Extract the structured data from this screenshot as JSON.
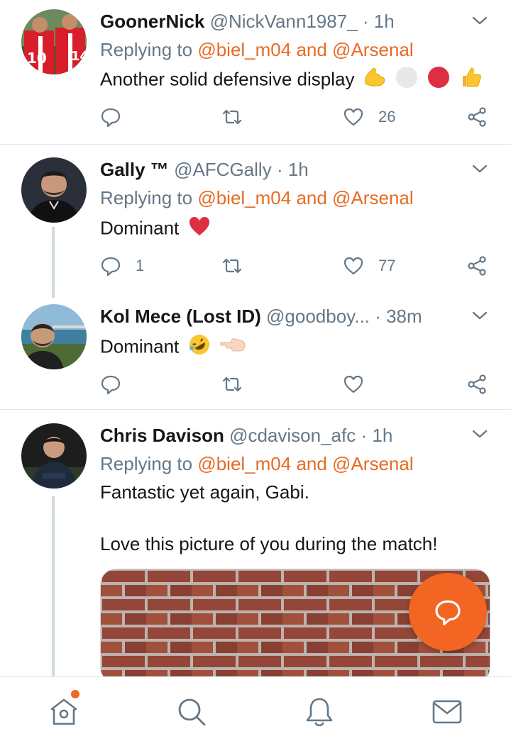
{
  "colors": {
    "accent": "#e86a24",
    "fab": "#f26522",
    "muted": "#657786",
    "divider": "#e1e8ed"
  },
  "tweets": [
    {
      "name": "GoonerNick",
      "handle": "@NickVann1987_",
      "sep": "·",
      "time": "1h",
      "replying_prefix": "Replying to",
      "replying_mentions": "@biel_m04 and @Arsenal",
      "text": "Another solid defensive display",
      "emojis": [
        "flexed-biceps",
        "white-circle",
        "red-circle",
        "thumbs-up"
      ],
      "reply_count": "",
      "like_count": "26"
    },
    {
      "name": "Gally ™",
      "handle": "@AFCGally",
      "sep": "·",
      "time": "1h",
      "replying_prefix": "Replying to",
      "replying_mentions": "@biel_m04 and @Arsenal",
      "text": "Dominant",
      "emojis": [
        "red-heart"
      ],
      "reply_count": "1",
      "like_count": "77"
    },
    {
      "name": "Kol Mece (Lost ID)",
      "handle": "@goodboy...",
      "sep": "·",
      "time": "38m",
      "text": "Dominant",
      "emojis": [
        "rolling-on-floor-laughing",
        "pointing-left-hand"
      ],
      "reply_count": "",
      "like_count": ""
    },
    {
      "name": "Chris Davison",
      "handle": "@cdavison_afc",
      "sep": "·",
      "time": "1h",
      "replying_prefix": "Replying to",
      "replying_mentions": "@biel_m04 and @Arsenal",
      "text_line1": "Fantastic yet again, Gabi.",
      "text_line2": "Love this picture of you during the match!",
      "media": "brick-wall-image"
    }
  ],
  "icons": {
    "reply": "reply-icon",
    "retweet": "retweet-icon",
    "like": "heart-icon",
    "share": "share-icon",
    "more": "chevron-down-icon",
    "compose": "compose-reply-icon",
    "nav": [
      "home-icon",
      "search-icon",
      "notifications-icon",
      "messages-icon"
    ]
  },
  "nav": {
    "home_has_badge": true
  }
}
